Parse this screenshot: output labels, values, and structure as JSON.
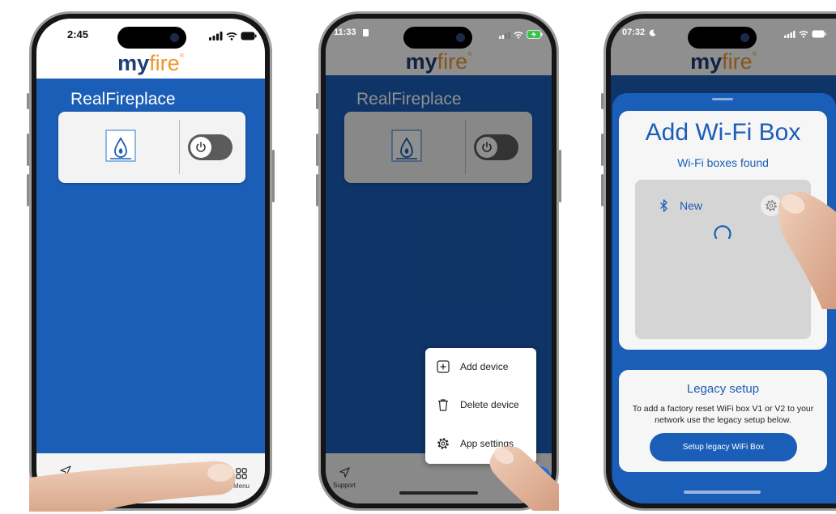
{
  "colors": {
    "brand_blue": "#1b5eb8",
    "logo_my": "#1d3e78",
    "logo_fire": "#f0962e",
    "card_bg": "#f3f3f3",
    "toggle_off": "#5b5b5b",
    "nav_bg": "#f4f4f4",
    "skin": "#e6bba2"
  },
  "phones": [
    {
      "status_time": "2:45",
      "logo": {
        "my": "my",
        "fire": "fire",
        "mark": "®"
      },
      "group_title": "RealFireplace",
      "device": {
        "icon": "fireplace-icon",
        "toggle_icon": "power-icon",
        "power_on": false
      },
      "nav": {
        "left_icon": "send-icon",
        "menu_icon": "grid-icon",
        "menu_label": "Menu"
      }
    },
    {
      "status_time": "11:33",
      "logo": {
        "my": "my",
        "fire": "fire",
        "mark": "®"
      },
      "group_title": "RealFireplace",
      "device": {
        "icon": "fireplace-icon",
        "toggle_icon": "power-icon",
        "power_on": false
      },
      "popup_menu": [
        {
          "icon": "plus-square-icon",
          "label": "Add device"
        },
        {
          "icon": "trash-icon",
          "label": "Delete device"
        },
        {
          "icon": "gear-icon",
          "label": "App settings"
        }
      ],
      "nav": {
        "support_icon": "send-icon",
        "support_label": "Support"
      }
    },
    {
      "status_time": "07:32",
      "logo": {
        "my": "my",
        "fire": "fire",
        "mark": "®"
      },
      "sheet": {
        "title": "Add Wi-Fi Box",
        "subtitle": "Wi-Fi boxes found",
        "found_devices": [
          {
            "icon": "bluetooth-icon",
            "name": "New",
            "action_icon": "gear-icon"
          }
        ],
        "legacy": {
          "title": "Legacy setup",
          "text": "To add a factory reset WiFi box V1 or V2 to your network use the legacy setup below.",
          "button_label": "Setup legacy WiFi Box"
        }
      }
    }
  ]
}
